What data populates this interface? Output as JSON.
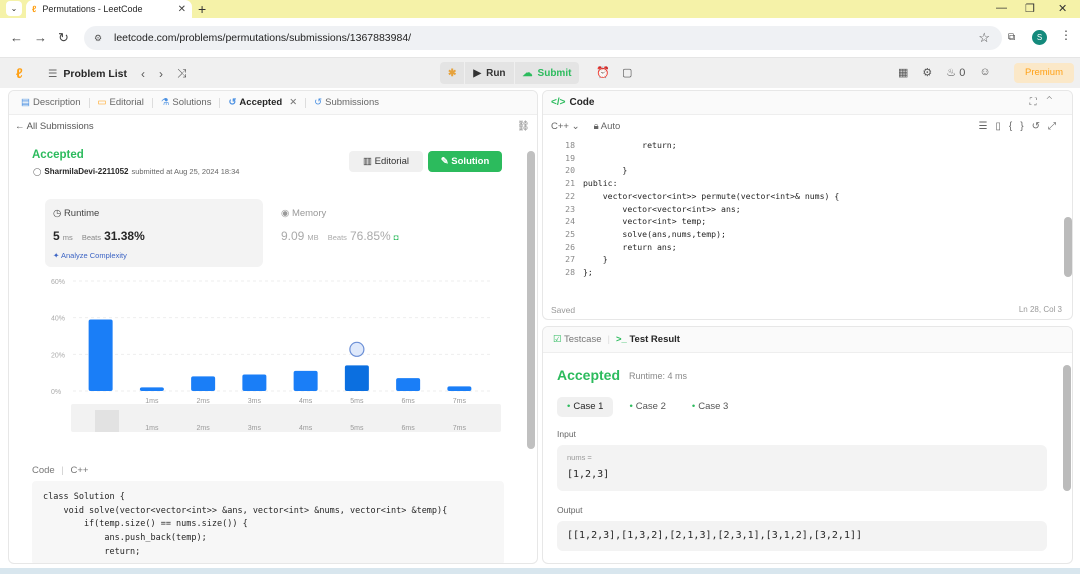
{
  "browser": {
    "tab_title": "Permutations - LeetCode",
    "url": "leetcode.com/problems/permutations/submissions/1367883984/",
    "profile_initial": "S"
  },
  "topnav": {
    "problem_list": "Problem List",
    "run": "Run",
    "submit": "Submit",
    "streak": "0",
    "premium": "Premium"
  },
  "left_tabs": [
    {
      "label": "Description",
      "icon": "description-icon"
    },
    {
      "label": "Editorial",
      "icon": "editorial-icon"
    },
    {
      "label": "Solutions",
      "icon": "flask-icon"
    },
    {
      "label": "Accepted",
      "icon": "history-icon"
    },
    {
      "label": "Submissions",
      "icon": "history-icon"
    }
  ],
  "submission": {
    "all_submissions": "All Submissions",
    "status": "Accepted",
    "author": "SharmilaDevi-2211052",
    "submitted_text": "submitted at Aug 25, 2024 18:34",
    "editorial_btn": "Editorial",
    "solution_btn": "Solution",
    "runtime_label": "Runtime",
    "runtime_value": "5",
    "runtime_unit": "ms",
    "runtime_beats_label": "Beats",
    "runtime_beats": "31.38%",
    "analyze": "Analyze Complexity",
    "memory_label": "Memory",
    "memory_value": "9.09",
    "memory_unit": "MB",
    "memory_beats_label": "Beats",
    "memory_beats": "76.85%"
  },
  "chart_data": {
    "type": "bar",
    "categories": [
      "",
      "1ms",
      "2ms",
      "3ms",
      "4ms",
      "5ms",
      "6ms",
      "7ms"
    ],
    "values": [
      39,
      2,
      8,
      9,
      11,
      14,
      7,
      2.5
    ],
    "ylim": [
      0,
      60
    ],
    "yticks": [
      "60%",
      "40%",
      "20%",
      "0%"
    ],
    "highlight": "5ms",
    "bar_color": "#1a7ef7",
    "grid": true
  },
  "code_section": {
    "header_code": "Code",
    "header_lang": "C++",
    "lines": [
      "class Solution {",
      "    void solve(vector<vector<int>> &ans, vector<int> &nums, vector<int> &temp){",
      "        if(temp.size() == nums.size()) {",
      "            ans.push_back(temp);",
      "            return;"
    ]
  },
  "editor": {
    "title": "Code",
    "lang": "C++",
    "mode": "Auto",
    "saved": "Saved",
    "cursor": "Ln 28, Col 3",
    "line_numbers": [
      "18",
      "19",
      "20",
      "21",
      "22",
      "23",
      "24",
      "25",
      "26",
      "27",
      "28"
    ],
    "lines": [
      "            return;",
      "",
      "        }",
      "public:",
      "    vector<vector<int>> permute(vector<int>& nums) {",
      "        vector<vector<int>> ans;",
      "        vector<int> temp;",
      "        solve(ans,nums,temp);",
      "        return ans;",
      "    }",
      "};"
    ]
  },
  "result": {
    "tab_testcase": "Testcase",
    "tab_result": "Test Result",
    "status": "Accepted",
    "runtime": "Runtime: 4 ms",
    "cases": [
      "Case 1",
      "Case 2",
      "Case 3"
    ],
    "input_label": "Input",
    "input_name": "nums =",
    "input_value": "[1,2,3]",
    "output_label": "Output",
    "output_value": "[[1,2,3],[1,3,2],[2,1,3],[2,3,1],[3,1,2],[3,2,1]]"
  }
}
